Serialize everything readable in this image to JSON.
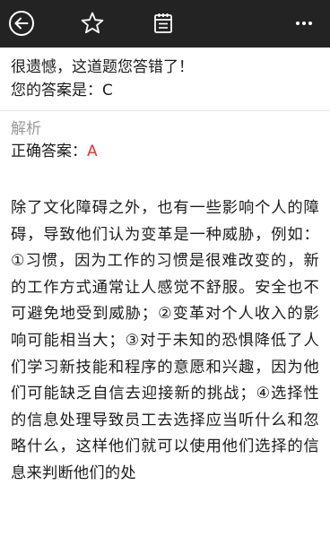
{
  "toolbar": {
    "back_icon": "back-circle-icon",
    "favorite_icon": "star-outline-icon",
    "notes_icon": "notes-icon",
    "more_icon": "more-dots-icon"
  },
  "result": {
    "message": "很遗憾，这道题您答错了！",
    "your_answer_prefix": "您的答案是：",
    "your_answer_value": "C"
  },
  "analysis": {
    "title": "解析",
    "correct_prefix": "正确答案：",
    "correct_value": "A",
    "correct_color": "#e8312f",
    "explanation": "除了文化障碍之外，也有一些影响个人的障碍，导致他们认为变革是一种威胁，例如：①习惯，因为工作的习惯是很难改变的，新的工作方式通常让人感觉不舒服。安全也不可避免地受到威胁；②变革对个人收入的影响可能相当大；③对于未知的恐惧降低了人们学习新技能和程序的意愿和兴趣，因为他们可能缺乏自信去迎接新的挑战；④选择性的信息处理导致员工去选择应当听什么和忽略什么，这样他们就可以使用他们选择的信息来判断他们的处"
  },
  "colors": {
    "toolbar_bg": "#232323",
    "text": "#1c1c1c",
    "muted": "#9a9a9a"
  }
}
